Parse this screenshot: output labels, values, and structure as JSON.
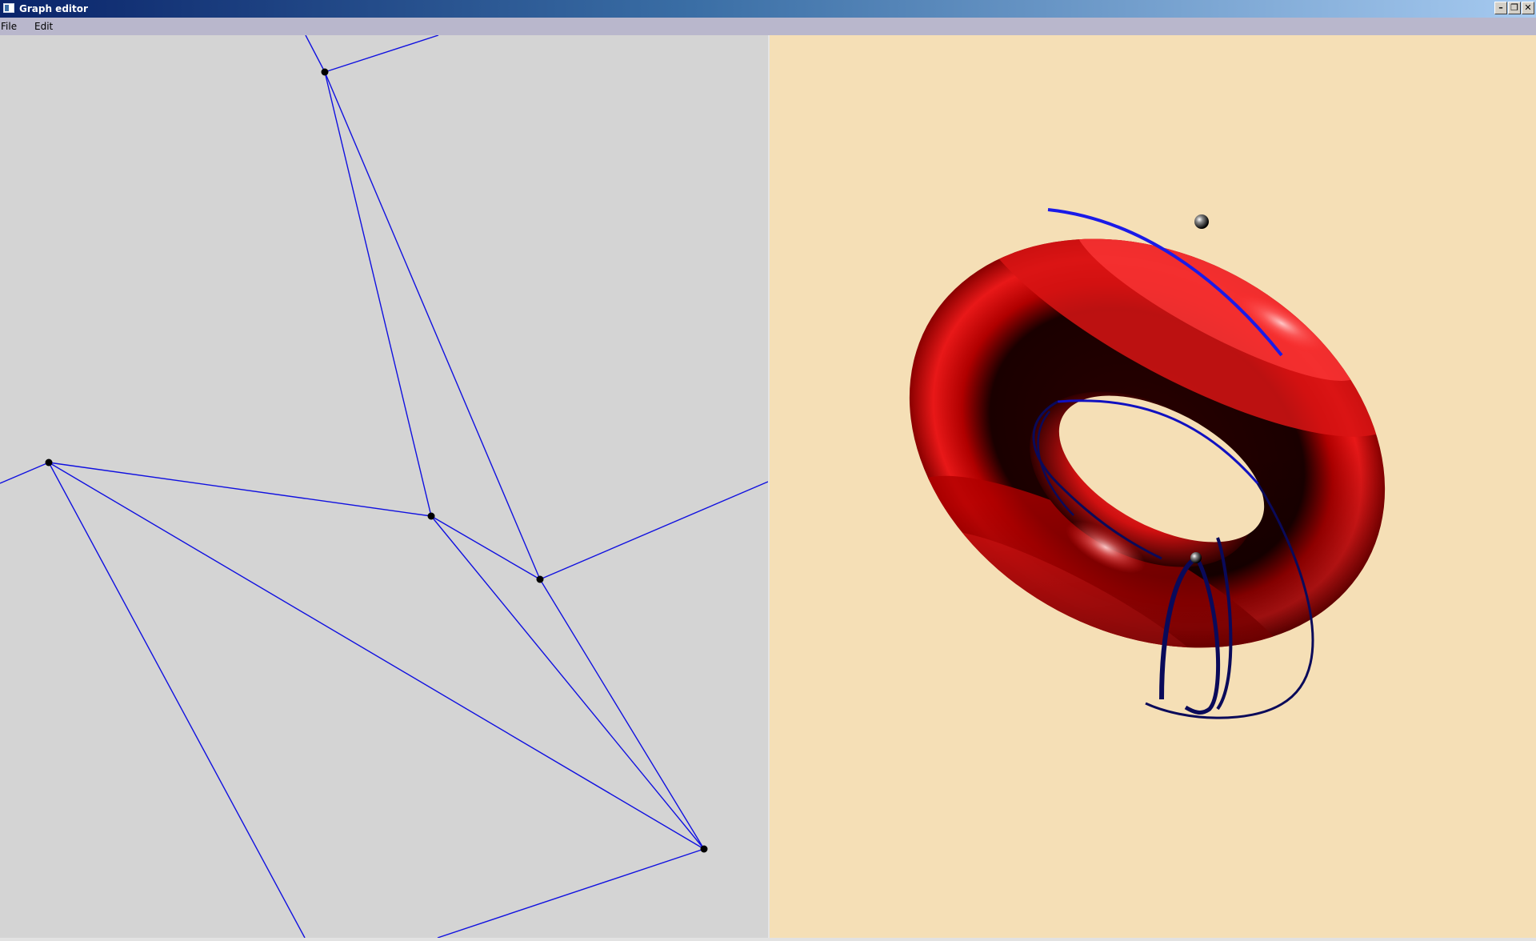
{
  "window": {
    "title": "Graph editor",
    "buttons": {
      "minimize": "–",
      "restore": "❐",
      "close": "✕"
    }
  },
  "menu": {
    "items": [
      {
        "label": "File"
      },
      {
        "label": "Edit"
      }
    ]
  },
  "colors": {
    "graph_background": "#d4d4d4",
    "edge": "#1010e0",
    "vertex": "#000000",
    "view_background": "#f5dfb6",
    "torus": "#e01010",
    "curve": "#0a0a5a"
  },
  "icons": {
    "app": "window-app-icon",
    "minimize": "minimize-icon",
    "restore": "restore-icon",
    "close": "close-icon"
  }
}
